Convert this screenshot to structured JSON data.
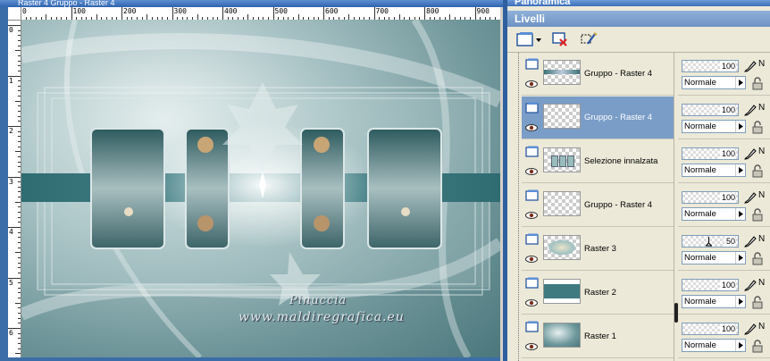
{
  "canvas_window": {
    "title": "Raster 4 Gruppo - Raster 4",
    "hruler_labels": [
      "0",
      "100",
      "200",
      "300",
      "400",
      "500",
      "600",
      "700",
      "800",
      "900"
    ],
    "vruler_labels": [
      "0",
      "1",
      "2",
      "3",
      "4",
      "5",
      "6"
    ],
    "watermark_line1": "Pinuccia",
    "watermark_line2": "www.maldiregrafica.eu"
  },
  "palette": {
    "window_title": "Panoramica",
    "header": "Livelli",
    "toolbar": {
      "new_layer_icon": "new-raster-layer-icon",
      "delete_icon": "delete-layer-icon",
      "mask_icon": "edit-selection-icon"
    },
    "layers": [
      {
        "name": "Gruppo - Raster 4",
        "opacity": "100",
        "blend": "Normale",
        "selected": false,
        "thumb": "strip"
      },
      {
        "name": "Gruppo - Raster 4",
        "opacity": "100",
        "blend": "Normale",
        "selected": true,
        "thumb": "empty"
      },
      {
        "name": "Selezione innalzata",
        "opacity": "100",
        "blend": "Normale",
        "selected": false,
        "thumb": "frames"
      },
      {
        "name": "Gruppo - Raster 4",
        "opacity": "100",
        "blend": "Normale",
        "selected": false,
        "thumb": "empty"
      },
      {
        "name": "Raster 3",
        "opacity": "50",
        "blend": "Normale",
        "selected": false,
        "thumb": "flowers"
      },
      {
        "name": "Raster 2",
        "opacity": "100",
        "blend": "Normale",
        "selected": false,
        "thumb": "band"
      },
      {
        "name": "Raster 1",
        "opacity": "100",
        "blend": "Normale",
        "selected": false,
        "thumb": "gradient"
      }
    ],
    "colors": {
      "selected_row": "#7a9dc8",
      "panel_bg": "#ece9d8",
      "header_bg": "#7da2cf"
    }
  }
}
